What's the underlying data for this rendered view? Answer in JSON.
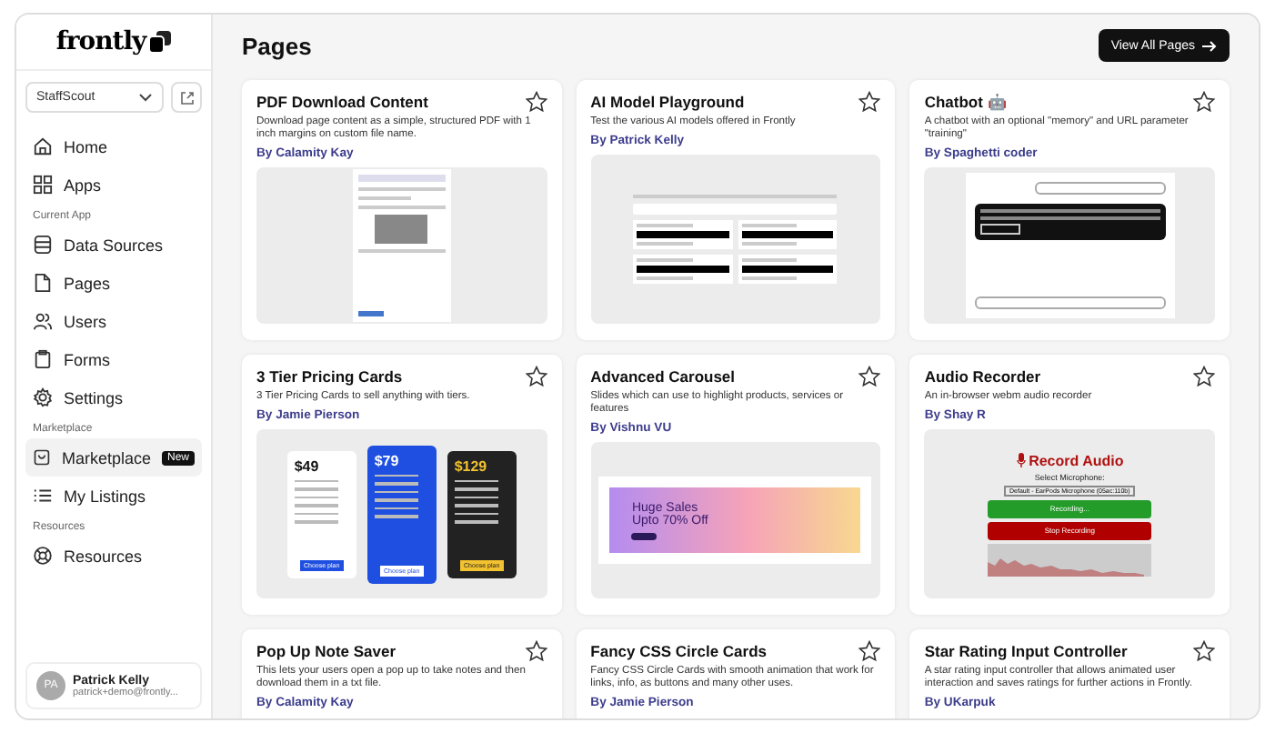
{
  "sidebar": {
    "logo": "frontly",
    "app_select": {
      "value": "StaffScout"
    },
    "sections": [
      {
        "items": [
          {
            "label": "Home",
            "selected": false
          },
          {
            "label": "Apps",
            "selected": false
          }
        ]
      },
      {
        "header": "Current App",
        "items": [
          {
            "label": "Data Sources",
            "selected": false
          },
          {
            "label": "Pages",
            "selected": false
          },
          {
            "label": "Users",
            "selected": false
          },
          {
            "label": "Forms",
            "selected": false
          },
          {
            "label": "Settings",
            "selected": false
          }
        ]
      },
      {
        "header": "Marketplace",
        "items": [
          {
            "label": "Marketplace",
            "selected": true,
            "badge": "New"
          },
          {
            "label": "My Listings",
            "selected": false
          }
        ]
      },
      {
        "header": "Resources",
        "items": [
          {
            "label": "Resources",
            "selected": false
          }
        ]
      }
    ],
    "user": {
      "initials": "PA",
      "name": "Patrick Kelly",
      "email": "patrick+demo@frontly..."
    }
  },
  "page": {
    "title": "Pages",
    "button": "View All Pages"
  },
  "cards": [
    {
      "title": "PDF Download Content",
      "description": "Download page content as a simple, structured PDF with 1 inch margins on custom file name.",
      "author": "By Calamity Kay",
      "preview": {
        "kind": "pdf"
      }
    },
    {
      "title": "AI Model Playground",
      "description": "Test the various AI models offered in Frontly",
      "author": "By Patrick Kelly",
      "preview": {
        "kind": "ai"
      }
    },
    {
      "title": "Chatbot 🤖",
      "description": "A chatbot with an optional \"memory\" and URL parameter \"training\"",
      "author": "By Spaghetti coder",
      "preview": {
        "kind": "chat"
      }
    },
    {
      "title": "3 Tier Pricing Cards",
      "description": "3 Tier Pricing Cards to sell anything with tiers.",
      "author": "By Jamie Pierson",
      "preview": {
        "kind": "pricing",
        "prices": [
          "$49",
          "$79",
          "$129"
        ],
        "buttons": [
          "Choose plan",
          "Choose plan",
          "Choose plan"
        ]
      }
    },
    {
      "title": "Advanced Carousel",
      "description": "Slides which can use to highlight products, services or features",
      "author": "By Vishnu VU",
      "preview": {
        "kind": "carousel",
        "lines": [
          "Huge Sales",
          "Upto 70% Off"
        ]
      }
    },
    {
      "title": "Audio Recorder",
      "description": "An in-browser webm audio recorder",
      "author": "By Shay R",
      "preview": {
        "kind": "audio",
        "heading": "Record Audio",
        "label": "Select Microphone:",
        "device": "Default - EarPods Microphone (05ac:110b)",
        "record": "Recording...",
        "stop": "Stop Recording"
      }
    },
    {
      "title": "Pop Up Note Saver",
      "description": "This lets your users open a pop up to take notes and then download them in a txt file.",
      "author": "By Calamity Kay"
    },
    {
      "title": "Fancy CSS Circle Cards",
      "description": "Fancy CSS Circle Cards with smooth animation that work for links, info, as buttons and many other uses.",
      "author": "By Jamie Pierson"
    },
    {
      "title": "Star Rating Input Controller",
      "description": "A star rating input controller that allows animated user interaction and saves ratings for further actions in Frontly.",
      "author": "By UKarpuk"
    }
  ]
}
